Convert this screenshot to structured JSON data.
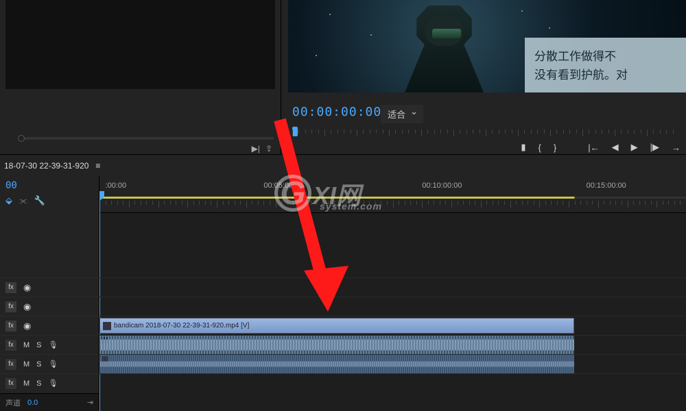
{
  "subtitle": {
    "line1": "分散工作做得不",
    "line2": "没有看到护航。对"
  },
  "program": {
    "timecode": "00:00:00:00",
    "fit_label": "适合"
  },
  "transport": {
    "mark_in": "{",
    "mark_out": "}",
    "go_in": "|←",
    "step_back": "◀",
    "play": "▶",
    "step_fwd": "|▶",
    "go_out": "→"
  },
  "source_btns": {
    "insert": "▶|",
    "overwrite": "⇪"
  },
  "sequence": {
    "name": "18-07-30 22-39-31-920",
    "menu": "≡"
  },
  "timeline": {
    "timecode": "00",
    "ruler_labels": [
      {
        "pos": 1,
        "text": ":00:00"
      },
      {
        "pos": 28,
        "text": "00:05:00:00"
      },
      {
        "pos": 55,
        "text": "00:10:00:00"
      },
      {
        "pos": 83,
        "text": "00:15:00:00"
      }
    ],
    "clip_name": "bandicam 2018-07-30 22-39-31-920.mp4 [V]"
  },
  "tracks": {
    "v3": {
      "fx": "fx",
      "eye": "◉"
    },
    "v2": {
      "fx": "fx",
      "eye": "◉"
    },
    "v1": {
      "fx": "fx",
      "eye": "◉"
    },
    "a1": {
      "fx": "fx",
      "m": "M",
      "s": "S",
      "mic": "🎙"
    },
    "a2": {
      "fx": "fx",
      "m": "M",
      "s": "S",
      "mic": "🎙"
    },
    "a3": {
      "fx": "fx",
      "m": "M",
      "s": "S",
      "mic": "🎙"
    }
  },
  "bottom": {
    "label": "声道",
    "value": "0.0",
    "snap": "⇥"
  },
  "watermark": {
    "g": "G",
    "main": "XI网",
    "sub": "system.com"
  }
}
